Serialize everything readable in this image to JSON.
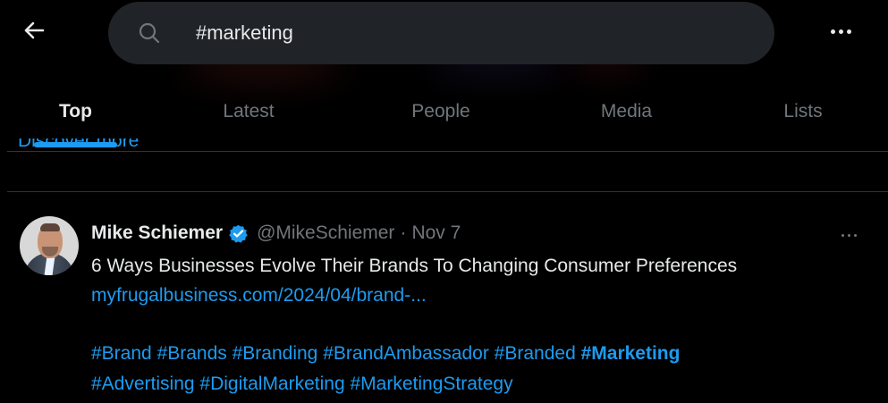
{
  "search": {
    "value": "#marketing"
  },
  "tabs": [
    {
      "label": "Top"
    },
    {
      "label": "Latest"
    },
    {
      "label": "People"
    },
    {
      "label": "Media"
    },
    {
      "label": "Lists"
    }
  ],
  "discover": {
    "label": "Discover more"
  },
  "tweet": {
    "display_name": "Mike Schiemer",
    "handle": "@MikeSchiemer",
    "separator": "·",
    "date": "Nov 7",
    "text": "6 Ways Businesses Evolve Their Brands To Changing Consumer Preferences",
    "link": "myfrugalbusiness.com/2024/04/brand-...",
    "hashtags": [
      "#Brand",
      "#Brands",
      "#Branding",
      "#BrandAmbassador",
      "#Branded",
      "#Marketing",
      "#Advertising",
      "#DigitalMarketing",
      "#MarketingStrategy"
    ]
  },
  "icons": {
    "back": "arrow-left-icon",
    "search": "search-icon",
    "more": "more-horizontal-icon",
    "verified": "verified-badge-icon"
  },
  "colors": {
    "accent": "#1d9bf0",
    "background": "#000000",
    "search_background": "#202327",
    "text": "#e7e9ea",
    "muted": "#71767b"
  }
}
